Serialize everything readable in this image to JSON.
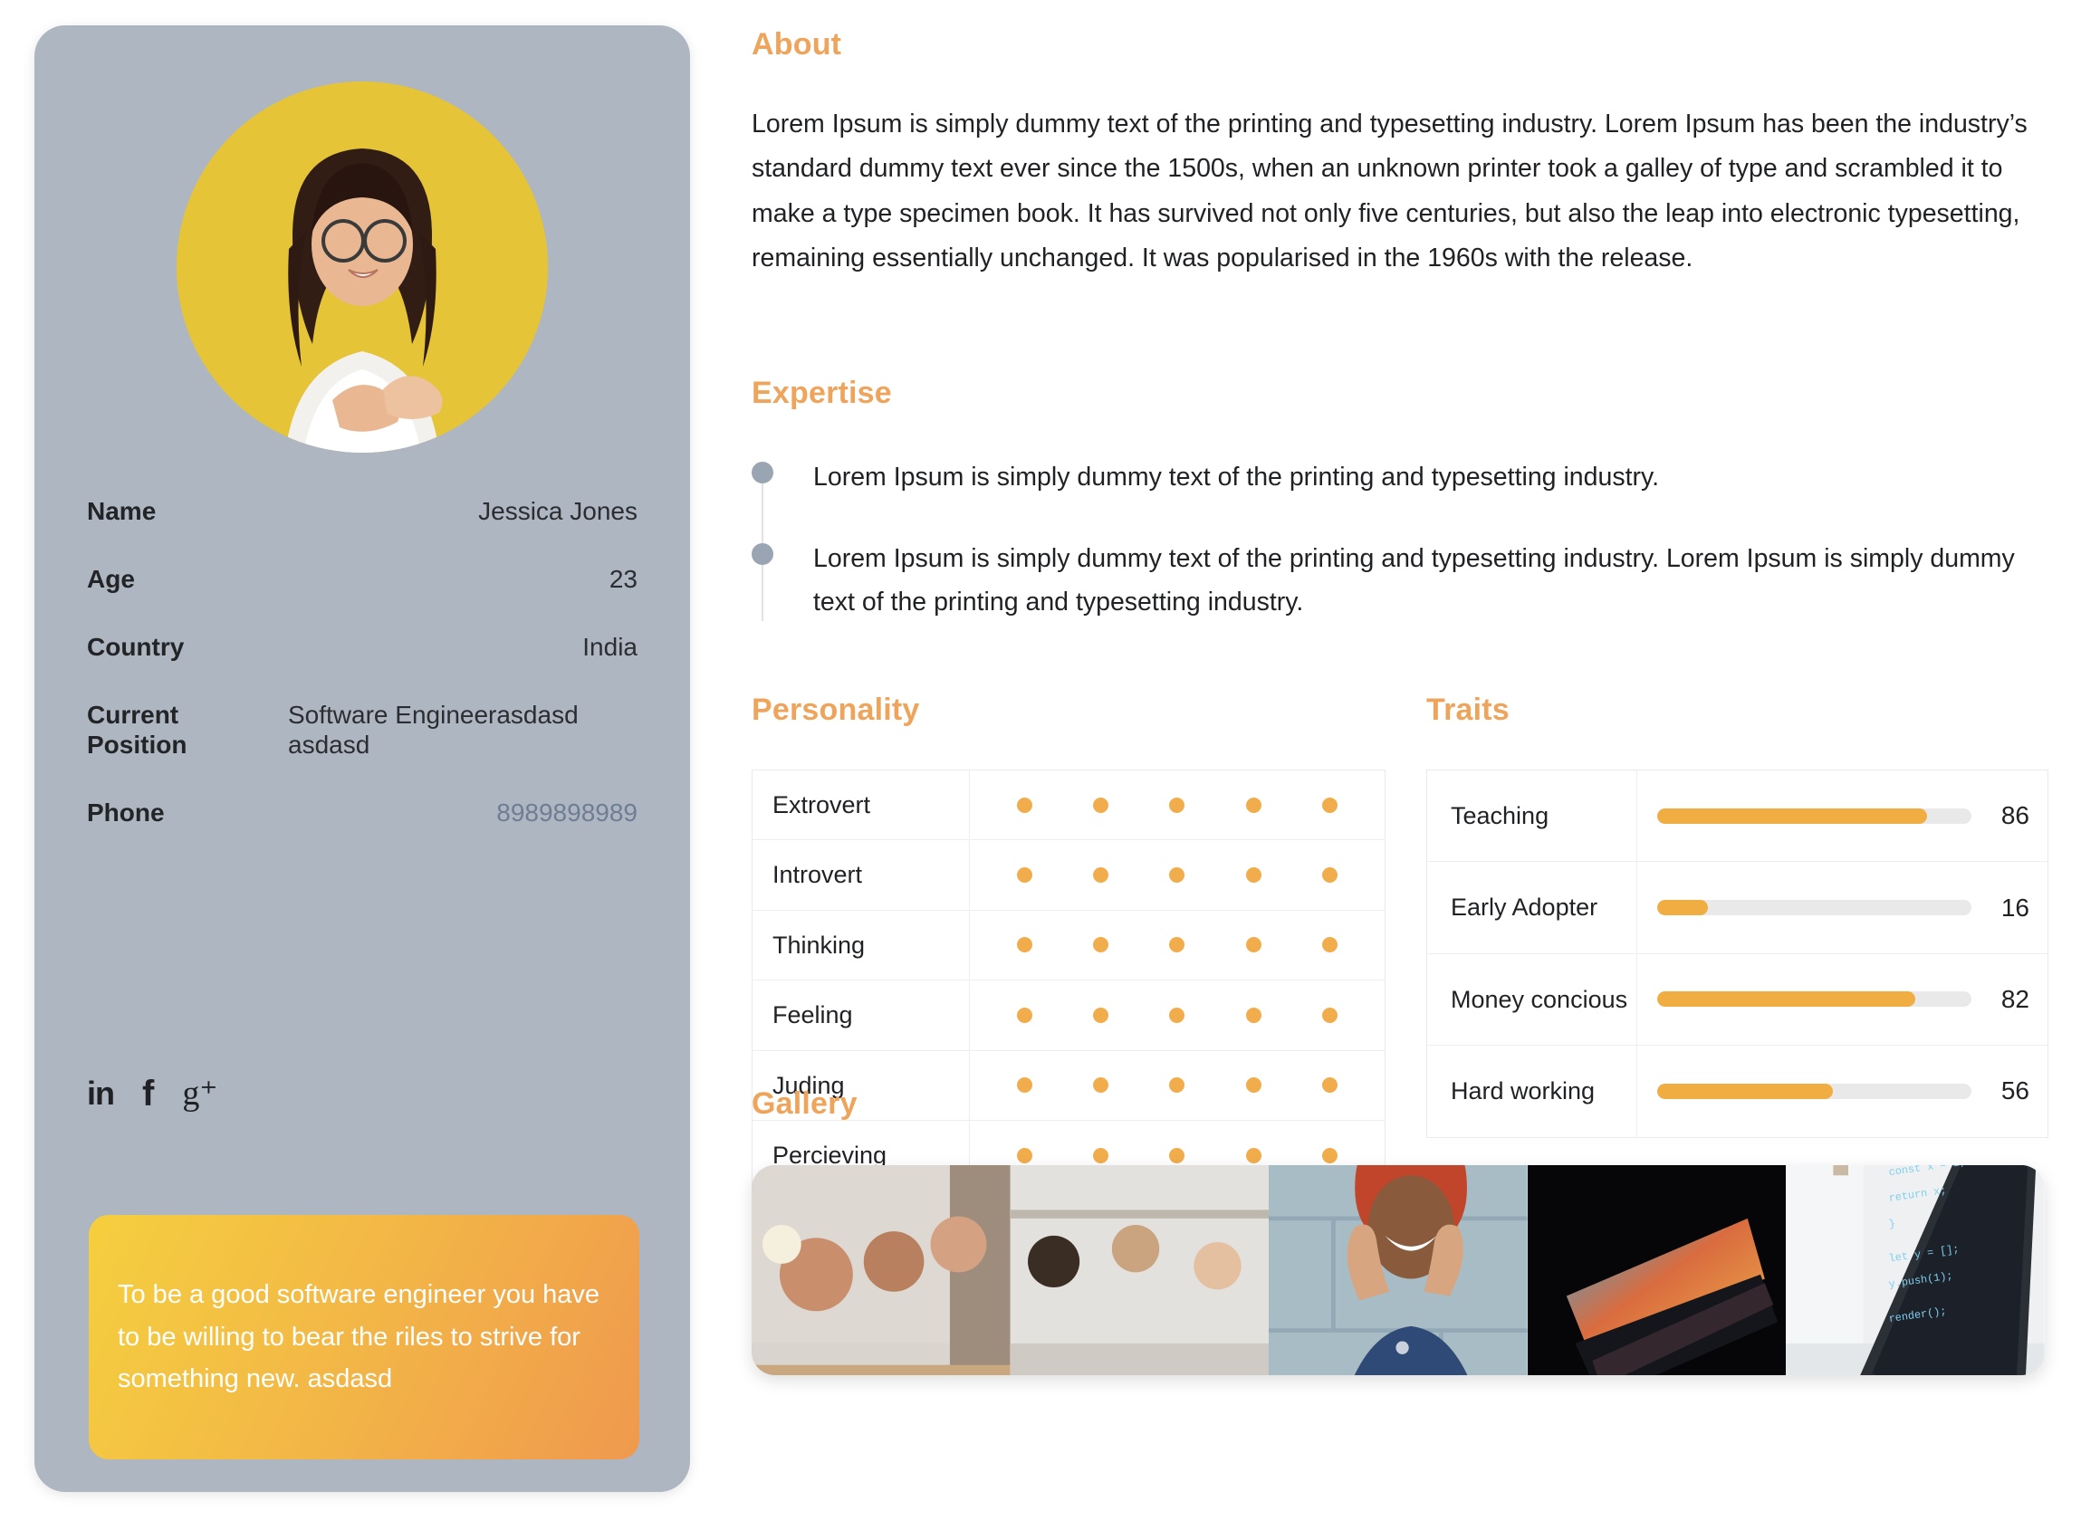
{
  "profile": {
    "avatar": {
      "icon": "user-avatar-photo",
      "background_color": "#e5c437"
    },
    "fields": [
      {
        "label": "Name",
        "value": "Jessica Jones",
        "align": "right"
      },
      {
        "label": "Age",
        "value": "23",
        "align": "right"
      },
      {
        "label": "Country",
        "value": "India",
        "align": "right"
      },
      {
        "label": "Current Position",
        "value": "Software Engineerasdasd asdasd",
        "align": "left"
      },
      {
        "label": "Phone",
        "value": "8989898989",
        "align": "right"
      }
    ],
    "socials": [
      {
        "name": "linkedin-icon",
        "glyph": "in"
      },
      {
        "name": "facebook-icon",
        "glyph": "f"
      },
      {
        "name": "google-plus-icon",
        "glyph": "g⁺"
      }
    ],
    "quote": "To be a good software engineer you have to be willing to bear the riles to strive for something new. asdasd",
    "card_color": "#aeb6c2"
  },
  "about": {
    "title": "About",
    "body": "Lorem Ipsum is simply dummy text of the printing and typesetting industry. Lorem Ipsum has been the industry’s standard dummy text ever since the 1500s, when an unknown printer took a galley of type and scrambled it to make a type specimen book. It has survived not only five centuries, but also the leap into electronic typesetting, remaining essentially unchanged. It was popularised in the 1960s with the release."
  },
  "expertise": {
    "title": "Expertise",
    "items": [
      "Lorem Ipsum is simply dummy text of the printing and typesetting industry.",
      "Lorem Ipsum is simply dummy text of the printing and typesetting industry. Lorem Ipsum is simply dummy text of the printing and typesetting industry."
    ]
  },
  "personality": {
    "title": "Personality",
    "max_dots": 5,
    "rows": [
      {
        "label": "Extrovert",
        "filled": 5
      },
      {
        "label": "Introvert",
        "filled": 5
      },
      {
        "label": "Thinking",
        "filled": 5
      },
      {
        "label": "Feeling",
        "filled": 5
      },
      {
        "label": "Juding",
        "filled": 5
      },
      {
        "label": "Percieving",
        "filled": 5
      }
    ]
  },
  "traits": {
    "title": "Traits",
    "max": 100,
    "rows": [
      {
        "label": "Teaching",
        "value": 86
      },
      {
        "label": "Early Adopter",
        "value": 16
      },
      {
        "label": "Money concious",
        "value": 82
      },
      {
        "label": "Hard working",
        "value": 56
      }
    ]
  },
  "gallery": {
    "title": "Gallery",
    "images": [
      {
        "name": "gallery-image-meeting-cafe"
      },
      {
        "name": "gallery-image-open-office"
      },
      {
        "name": "gallery-image-woman-pointing"
      },
      {
        "name": "gallery-image-dark-laptop"
      },
      {
        "name": "gallery-image-code-laptop"
      }
    ]
  },
  "colors": {
    "accent_orange": "#efa45c",
    "meter_fill": "#f0ad41",
    "meter_track": "#e9e9e9",
    "card_bg": "#aeb6c2",
    "phone_text": "#6f7d92",
    "bullet_gray": "#9aa5b4"
  }
}
